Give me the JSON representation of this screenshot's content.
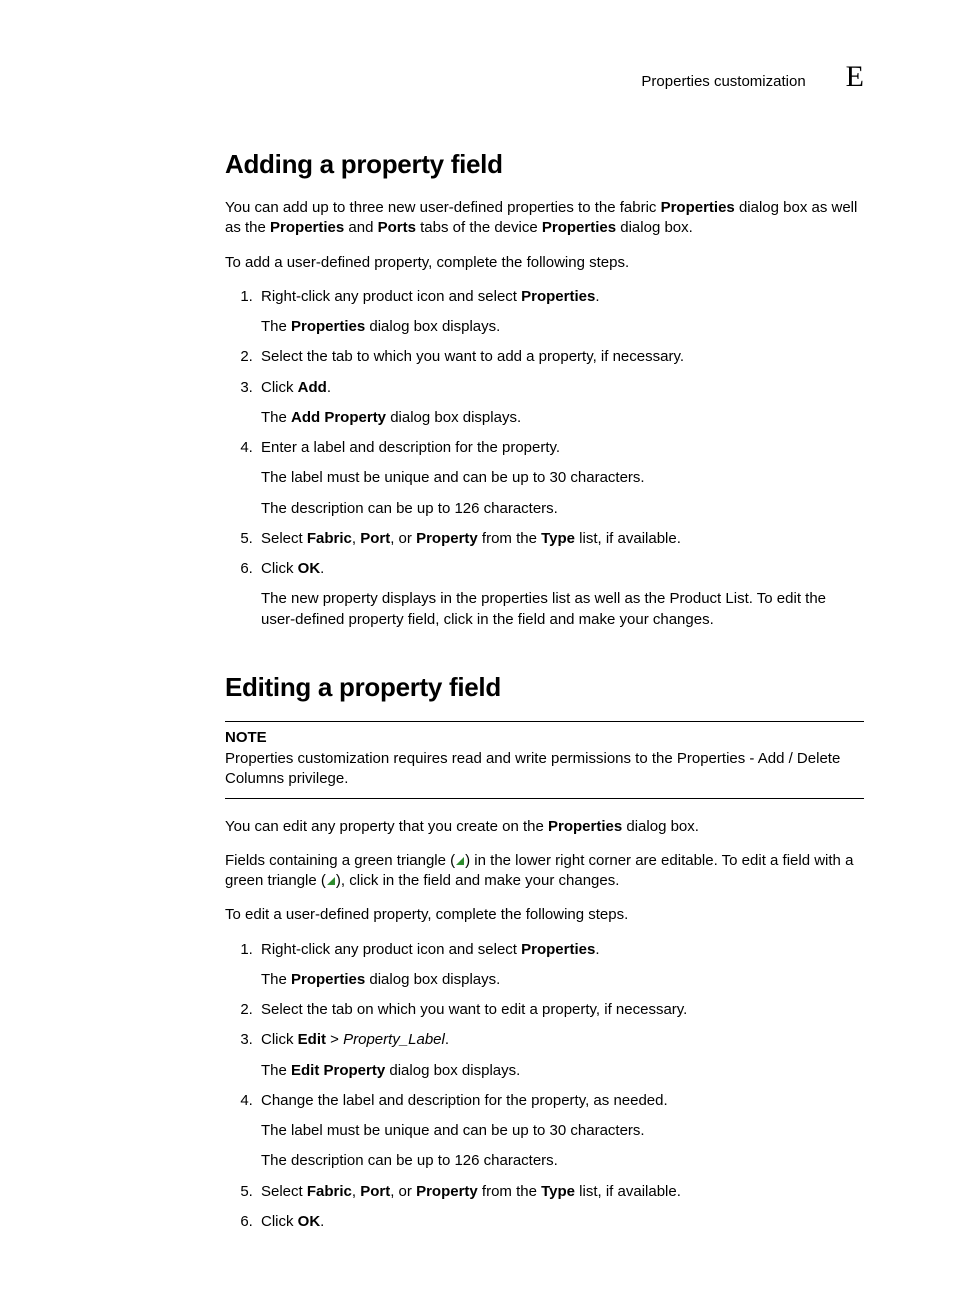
{
  "header": {
    "running_title": "Properties customization",
    "appendix_marker": "E"
  },
  "addSection": {
    "heading": "Adding a property field",
    "intro_1_a": "You can add up to three new user-defined properties to the fabric ",
    "intro_1_b": " dialog box as well as the ",
    "intro_1_c": " and ",
    "intro_1_d": " tabs of the device ",
    "intro_1_e": " dialog box.",
    "intro_2": "To add a user-defined property, complete the following steps.",
    "s1_a": "Right-click any product icon and select ",
    "s1_b": ".",
    "s1_sub_a": "The ",
    "s1_sub_b": " dialog box displays.",
    "s2": "Select the tab to which you want to add a property, if necessary.",
    "s3_a": "Click ",
    "s3_b": ".",
    "s3_sub_a": "The ",
    "s3_sub_b": " dialog box displays.",
    "s4": "Enter a label and description for the property.",
    "s4_sub1": "The label must be unique and can be up to 30 characters.",
    "s4_sub2": "The description can be up to 126 characters.",
    "s5_a": "Select ",
    "s5_b": ", ",
    "s5_c": ", or ",
    "s5_d": " from the ",
    "s5_e": " list, if available.",
    "s6_a": "Click ",
    "s6_b": ".",
    "s6_sub": "The new property displays in the properties list as well as the Product List. To edit the user-defined property field, click in the field and make your changes."
  },
  "editSection": {
    "heading": "Editing a property field",
    "note_label": "NOTE",
    "note_body": "Properties customization requires read and write permissions to the Properties - Add / Delete Columns privilege.",
    "p1_a": "You can edit any property that you create on the ",
    "p1_b": " dialog box.",
    "p2_a": "Fields containing a green triangle (",
    "p2_b": ") in the lower right corner are editable. To edit a field with a green triangle (",
    "p2_c": "), click in the field and make your changes.",
    "p3": "To edit a user-defined property, complete the following steps.",
    "s1_a": "Right-click any product icon and select ",
    "s1_b": ".",
    "s1_sub_a": "The ",
    "s1_sub_b": " dialog box displays.",
    "s2": "Select the tab on which you want to edit a property, if necessary.",
    "s3_a": "Click ",
    "s3_b": " > ",
    "s3_c": ".",
    "s3_sub_a": "The ",
    "s3_sub_b": " dialog box displays.",
    "s4": "Change the label and description for the property, as needed.",
    "s4_sub1": "The label must be unique and can be up to 30 characters.",
    "s4_sub2": "The description can be up to 126 characters.",
    "s5_a": "Select ",
    "s5_b": ", ",
    "s5_c": ", or ",
    "s5_d": " from the ",
    "s5_e": " list, if available.",
    "s6_a": "Click ",
    "s6_b": "."
  },
  "terms": {
    "Properties": "Properties",
    "Ports": "Ports",
    "Add": "Add",
    "AddProperty": "Add Property",
    "Fabric": "Fabric",
    "Port": "Port",
    "Property": "Property",
    "Type": "Type",
    "OK": "OK",
    "Edit": "Edit",
    "EditProperty": "Edit Property",
    "Property_Label": "Property_Label"
  },
  "icons": {
    "triangle_color": "#2e8b2e"
  }
}
